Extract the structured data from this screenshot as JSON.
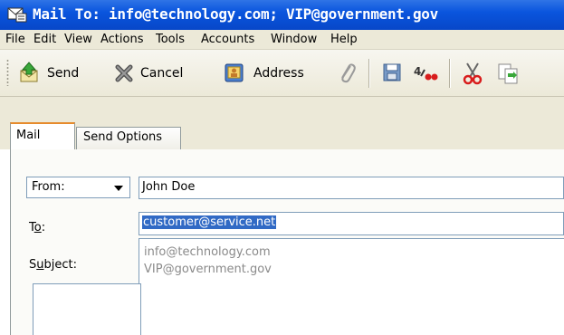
{
  "window": {
    "title": "Mail To: info@technology.com; VIP@government.gov"
  },
  "menu": [
    "File",
    "Edit",
    "View",
    "Actions",
    "Tools",
    "Accounts",
    "Window",
    "Help"
  ],
  "toolbar": {
    "send_label": "Send",
    "cancel_label": "Cancel",
    "address_label": "Address"
  },
  "tabs": {
    "mail": "Mail",
    "send_options": "Send Options"
  },
  "form": {
    "from_label": "From:",
    "from_value": "John Doe",
    "to_label": "To:",
    "to_value": "customer@service.net",
    "subject_label": "Subject:"
  },
  "autocomplete": [
    "info@technology.com",
    "VIP@government.gov"
  ],
  "colors": {
    "titlebar": "#0a55de",
    "selection": "#316ac5",
    "active_tab_accent": "#e68b2c"
  }
}
